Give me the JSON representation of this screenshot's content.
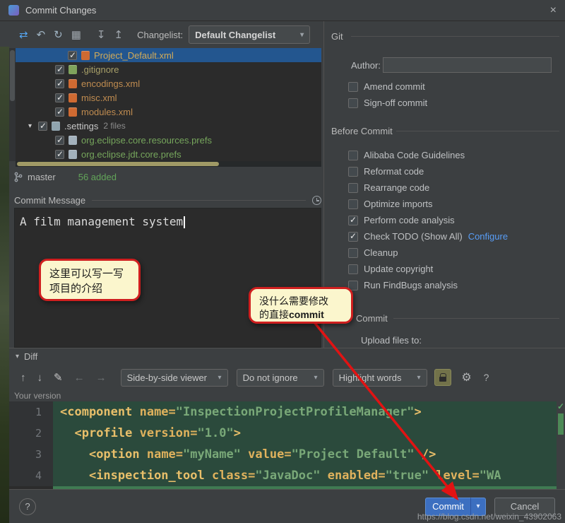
{
  "window": {
    "title": "Commit Changes"
  },
  "ui": {
    "chevron": "▾",
    "close": "×",
    "gear": "⚙",
    "help": "?",
    "check": "✓"
  },
  "colors": {
    "selection_blue": "#23568f",
    "accent_button_blue": "#3c6fc0",
    "added_green": "#62a559",
    "link_blue": "#589df6",
    "callout_border_red": "#cf1f1f",
    "callout_background": "#fbf6cd",
    "diff_added_background": "#2b4a3c"
  },
  "toolbar": {
    "icons": [
      {
        "name": "show-diff-icon",
        "glyph": "⇄",
        "color": "#56a8f5"
      },
      {
        "name": "rollback-icon",
        "glyph": "↶",
        "color": "#9fb3c2"
      },
      {
        "name": "refresh-icon",
        "glyph": "↻",
        "color": "#9fb3c2"
      },
      {
        "name": "group-by-icon",
        "glyph": "▦",
        "color": "#9fa6ad"
      },
      {
        "name": "expand-all-icon",
        "glyph": "↧",
        "color": "#9fa6ad"
      },
      {
        "name": "collapse-all-icon",
        "glyph": "↥",
        "color": "#9fa6ad"
      }
    ],
    "changelist_label": "Changelist:",
    "changelist_value": "Default Changelist"
  },
  "tree": {
    "items": [
      {
        "label": "Project_Default.xml",
        "checked": true,
        "selected": true,
        "indent": 74,
        "color": "#d3ab58",
        "icon": "xml-file",
        "icon_color": "#cf6a32"
      },
      {
        "label": ".gitignore",
        "checked": true,
        "selected": false,
        "indent": 56,
        "color": "#a8a069",
        "icon": "gitignore-file",
        "icon_color": "#7fa35c"
      },
      {
        "label": "encodings.xml",
        "checked": true,
        "selected": false,
        "indent": 56,
        "color": "#c08c50",
        "icon": "xml-file",
        "icon_color": "#cf6a32"
      },
      {
        "label": "misc.xml",
        "checked": true,
        "selected": false,
        "indent": 56,
        "color": "#c08c50",
        "icon": "xml-file",
        "icon_color": "#cf6a32"
      },
      {
        "label": "modules.xml",
        "checked": true,
        "selected": false,
        "indent": 56,
        "color": "#c08c50",
        "icon": "xml-file",
        "icon_color": "#cf6a32"
      },
      {
        "label": ".settings",
        "suffix": "2 files",
        "checked": true,
        "selected": false,
        "indent": 18,
        "expander": true,
        "color": "#c8c8c8",
        "icon": "folder",
        "icon_color": "#90a4ae"
      },
      {
        "label": "org.eclipse.core.resources.prefs",
        "checked": true,
        "selected": false,
        "indent": 56,
        "color": "#76a65c",
        "icon": "prefs-file",
        "icon_color": "#a3b1bc"
      },
      {
        "label": "org.eclipse.jdt.core.prefs",
        "checked": true,
        "selected": false,
        "indent": 56,
        "color": "#76a65c",
        "icon": "prefs-file",
        "icon_color": "#a3b1bc"
      }
    ]
  },
  "branch": {
    "name": "master",
    "added": "56 added"
  },
  "commit_message": {
    "label": "Commit Message",
    "text": "A film management system"
  },
  "callouts": {
    "one_line1": "这里可以写一写",
    "one_line2": "项目的介绍",
    "two_line1": "没什么需要修改",
    "two_line2_prefix": "的直接",
    "two_line2_bold": "commit"
  },
  "right_panel": {
    "git_label": "Git",
    "author_label": "Author:",
    "options": [
      {
        "label": "Amend commit",
        "checked": false
      },
      {
        "label": "Sign-off commit",
        "checked": false
      }
    ],
    "before_commit_label": "Before Commit",
    "checks": [
      {
        "label": "Alibaba Code Guidelines",
        "checked": false
      },
      {
        "label": "Reformat code",
        "checked": false
      },
      {
        "label": "Rearrange code",
        "checked": false
      },
      {
        "label": "Optimize imports",
        "checked": false
      },
      {
        "label": "Perform code analysis",
        "checked": true
      },
      {
        "label": "Check TODO (Show All)",
        "checked": true,
        "link": "Configure"
      },
      {
        "label": "Cleanup",
        "checked": false
      },
      {
        "label": "Update copyright",
        "checked": false
      },
      {
        "label": "Run FindBugs analysis",
        "checked": false
      }
    ],
    "commit_section_label": "Commit",
    "upload_label": "Upload files to:"
  },
  "diff": {
    "label": "Diff",
    "icons": [
      {
        "name": "previous-difference-icon",
        "glyph": "↑",
        "color": "#afb1b3"
      },
      {
        "name": "next-difference-icon",
        "glyph": "↓",
        "color": "#afb1b3"
      },
      {
        "name": "edit-source-icon",
        "glyph": "✎",
        "color": "#c7c7c7"
      },
      {
        "name": "previous-change-icon",
        "glyph": "←",
        "color": "#6f7375"
      },
      {
        "name": "next-change-icon",
        "glyph": "→",
        "color": "#6f7375"
      }
    ],
    "combos": [
      {
        "name": "viewer-select",
        "value": "Side-by-side viewer"
      },
      {
        "name": "ignore-select",
        "value": "Do not ignore"
      },
      {
        "name": "highlight-select",
        "value": "Highlight words"
      }
    ],
    "your_version_label": "Your version"
  },
  "editor": {
    "lines": [
      {
        "num": "1",
        "tokens": [
          {
            "t": "<component ",
            "c": "tag"
          },
          {
            "t": "name=",
            "c": "attr"
          },
          {
            "t": "\"InspectionProjectProfileManager\"",
            "c": "str"
          },
          {
            "t": ">",
            "c": "tag"
          }
        ]
      },
      {
        "num": "2",
        "tokens": [
          {
            "t": "  ",
            "c": "plain"
          },
          {
            "t": "<profile ",
            "c": "tag"
          },
          {
            "t": "version=",
            "c": "attr"
          },
          {
            "t": "\"1.0\"",
            "c": "str"
          },
          {
            "t": ">",
            "c": "tag"
          }
        ]
      },
      {
        "num": "3",
        "tokens": [
          {
            "t": "    ",
            "c": "plain"
          },
          {
            "t": "<option ",
            "c": "tag"
          },
          {
            "t": "name=",
            "c": "attr"
          },
          {
            "t": "\"myName\"",
            "c": "str"
          },
          {
            "t": " ",
            "c": "plain"
          },
          {
            "t": "value=",
            "c": "attr"
          },
          {
            "t": "\"Project Default\"",
            "c": "str"
          },
          {
            "t": " />",
            "c": "tag"
          }
        ]
      },
      {
        "num": "4",
        "tokens": [
          {
            "t": "    ",
            "c": "plain"
          },
          {
            "t": "<inspection_tool ",
            "c": "tag"
          },
          {
            "t": "class=",
            "c": "attr"
          },
          {
            "t": "\"JavaDoc\"",
            "c": "str"
          },
          {
            "t": " ",
            "c": "plain"
          },
          {
            "t": "enabled=",
            "c": "attr"
          },
          {
            "t": "\"true\"",
            "c": "str"
          },
          {
            "t": " ",
            "c": "plain"
          },
          {
            "t": "level=",
            "c": "attr"
          },
          {
            "t": "\"WA",
            "c": "str"
          }
        ]
      }
    ]
  },
  "footer": {
    "help": "?",
    "commit": "Commit",
    "cancel": "Cancel"
  },
  "watermark": "https://blog.csdn.net/weixin_43902063"
}
